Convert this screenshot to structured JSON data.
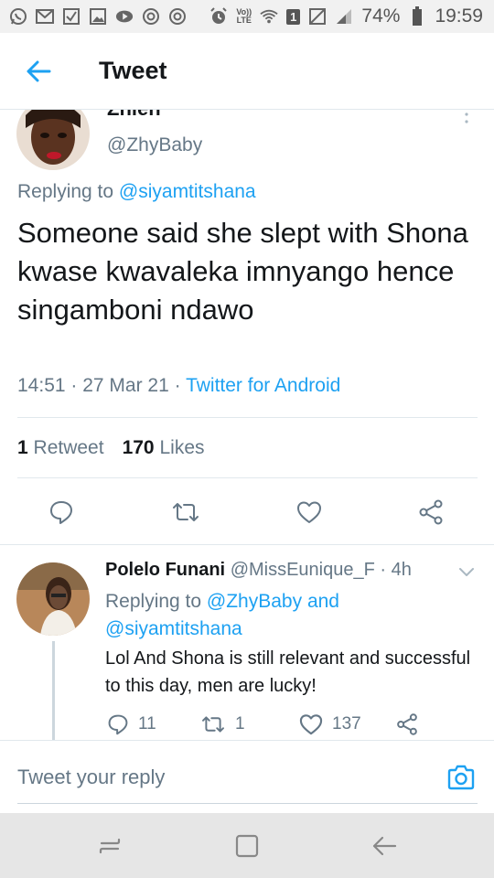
{
  "status_bar": {
    "battery": "74%",
    "time": "19:59",
    "volte_top": "Vo))",
    "volte_bottom": "LTE",
    "sim_badge": "1"
  },
  "header": {
    "title": "Tweet"
  },
  "main_tweet": {
    "author_name": "Zhieh",
    "author_handle": "@ZhyBaby",
    "replying_prefix": "Replying to ",
    "replying_to": "@siyamtitshana",
    "text": "Someone said she slept with Shona kwase kwavaleka imnyango hence singamboni ndawo",
    "timestamp": "14:51 · 27 Mar 21 · ",
    "source": "Twitter for Android",
    "retweet_count": "1",
    "retweet_label": "Retweet",
    "like_count": "170",
    "like_label": "Likes"
  },
  "reply_tweet": {
    "author_name": "Polelo Funani",
    "author_handle": "@MissEunique_F",
    "age": "· 4h",
    "replying_prefix": "Replying to ",
    "replying_to_1": "@ZhyBaby",
    "replying_join": " and",
    "replying_to_2": "@siyamtitshana",
    "text": "Lol And Shona is still relevant and successful to this day, men are lucky!",
    "reply_count": "11",
    "retweet_count": "1",
    "like_count": "137"
  },
  "composer": {
    "placeholder": "Tweet your reply"
  },
  "colors": {
    "accent": "#1da1f2",
    "text_primary": "#14171a",
    "text_secondary": "#657786",
    "divider": "#e1e8ed"
  },
  "icons": {
    "back": "arrow-left-icon",
    "reply": "reply-bubble-icon",
    "retweet": "retweet-icon",
    "like": "heart-icon",
    "share": "share-icon",
    "camera": "camera-icon"
  }
}
